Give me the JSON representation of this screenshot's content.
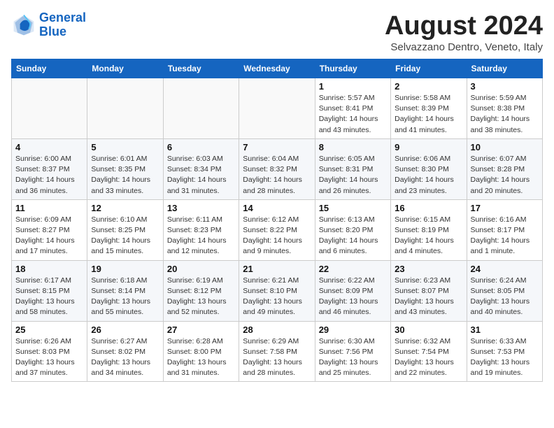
{
  "header": {
    "logo_line1": "General",
    "logo_line2": "Blue",
    "month_title": "August 2024",
    "subtitle": "Selvazzano Dentro, Veneto, Italy"
  },
  "weekdays": [
    "Sunday",
    "Monday",
    "Tuesday",
    "Wednesday",
    "Thursday",
    "Friday",
    "Saturday"
  ],
  "weeks": [
    [
      {
        "day": "",
        "detail": ""
      },
      {
        "day": "",
        "detail": ""
      },
      {
        "day": "",
        "detail": ""
      },
      {
        "day": "",
        "detail": ""
      },
      {
        "day": "1",
        "detail": "Sunrise: 5:57 AM\nSunset: 8:41 PM\nDaylight: 14 hours\nand 43 minutes."
      },
      {
        "day": "2",
        "detail": "Sunrise: 5:58 AM\nSunset: 8:39 PM\nDaylight: 14 hours\nand 41 minutes."
      },
      {
        "day": "3",
        "detail": "Sunrise: 5:59 AM\nSunset: 8:38 PM\nDaylight: 14 hours\nand 38 minutes."
      }
    ],
    [
      {
        "day": "4",
        "detail": "Sunrise: 6:00 AM\nSunset: 8:37 PM\nDaylight: 14 hours\nand 36 minutes."
      },
      {
        "day": "5",
        "detail": "Sunrise: 6:01 AM\nSunset: 8:35 PM\nDaylight: 14 hours\nand 33 minutes."
      },
      {
        "day": "6",
        "detail": "Sunrise: 6:03 AM\nSunset: 8:34 PM\nDaylight: 14 hours\nand 31 minutes."
      },
      {
        "day": "7",
        "detail": "Sunrise: 6:04 AM\nSunset: 8:32 PM\nDaylight: 14 hours\nand 28 minutes."
      },
      {
        "day": "8",
        "detail": "Sunrise: 6:05 AM\nSunset: 8:31 PM\nDaylight: 14 hours\nand 26 minutes."
      },
      {
        "day": "9",
        "detail": "Sunrise: 6:06 AM\nSunset: 8:30 PM\nDaylight: 14 hours\nand 23 minutes."
      },
      {
        "day": "10",
        "detail": "Sunrise: 6:07 AM\nSunset: 8:28 PM\nDaylight: 14 hours\nand 20 minutes."
      }
    ],
    [
      {
        "day": "11",
        "detail": "Sunrise: 6:09 AM\nSunset: 8:27 PM\nDaylight: 14 hours\nand 17 minutes."
      },
      {
        "day": "12",
        "detail": "Sunrise: 6:10 AM\nSunset: 8:25 PM\nDaylight: 14 hours\nand 15 minutes."
      },
      {
        "day": "13",
        "detail": "Sunrise: 6:11 AM\nSunset: 8:23 PM\nDaylight: 14 hours\nand 12 minutes."
      },
      {
        "day": "14",
        "detail": "Sunrise: 6:12 AM\nSunset: 8:22 PM\nDaylight: 14 hours\nand 9 minutes."
      },
      {
        "day": "15",
        "detail": "Sunrise: 6:13 AM\nSunset: 8:20 PM\nDaylight: 14 hours\nand 6 minutes."
      },
      {
        "day": "16",
        "detail": "Sunrise: 6:15 AM\nSunset: 8:19 PM\nDaylight: 14 hours\nand 4 minutes."
      },
      {
        "day": "17",
        "detail": "Sunrise: 6:16 AM\nSunset: 8:17 PM\nDaylight: 14 hours\nand 1 minute."
      }
    ],
    [
      {
        "day": "18",
        "detail": "Sunrise: 6:17 AM\nSunset: 8:15 PM\nDaylight: 13 hours\nand 58 minutes."
      },
      {
        "day": "19",
        "detail": "Sunrise: 6:18 AM\nSunset: 8:14 PM\nDaylight: 13 hours\nand 55 minutes."
      },
      {
        "day": "20",
        "detail": "Sunrise: 6:19 AM\nSunset: 8:12 PM\nDaylight: 13 hours\nand 52 minutes."
      },
      {
        "day": "21",
        "detail": "Sunrise: 6:21 AM\nSunset: 8:10 PM\nDaylight: 13 hours\nand 49 minutes."
      },
      {
        "day": "22",
        "detail": "Sunrise: 6:22 AM\nSunset: 8:09 PM\nDaylight: 13 hours\nand 46 minutes."
      },
      {
        "day": "23",
        "detail": "Sunrise: 6:23 AM\nSunset: 8:07 PM\nDaylight: 13 hours\nand 43 minutes."
      },
      {
        "day": "24",
        "detail": "Sunrise: 6:24 AM\nSunset: 8:05 PM\nDaylight: 13 hours\nand 40 minutes."
      }
    ],
    [
      {
        "day": "25",
        "detail": "Sunrise: 6:26 AM\nSunset: 8:03 PM\nDaylight: 13 hours\nand 37 minutes."
      },
      {
        "day": "26",
        "detail": "Sunrise: 6:27 AM\nSunset: 8:02 PM\nDaylight: 13 hours\nand 34 minutes."
      },
      {
        "day": "27",
        "detail": "Sunrise: 6:28 AM\nSunset: 8:00 PM\nDaylight: 13 hours\nand 31 minutes."
      },
      {
        "day": "28",
        "detail": "Sunrise: 6:29 AM\nSunset: 7:58 PM\nDaylight: 13 hours\nand 28 minutes."
      },
      {
        "day": "29",
        "detail": "Sunrise: 6:30 AM\nSunset: 7:56 PM\nDaylight: 13 hours\nand 25 minutes."
      },
      {
        "day": "30",
        "detail": "Sunrise: 6:32 AM\nSunset: 7:54 PM\nDaylight: 13 hours\nand 22 minutes."
      },
      {
        "day": "31",
        "detail": "Sunrise: 6:33 AM\nSunset: 7:53 PM\nDaylight: 13 hours\nand 19 minutes."
      }
    ]
  ]
}
